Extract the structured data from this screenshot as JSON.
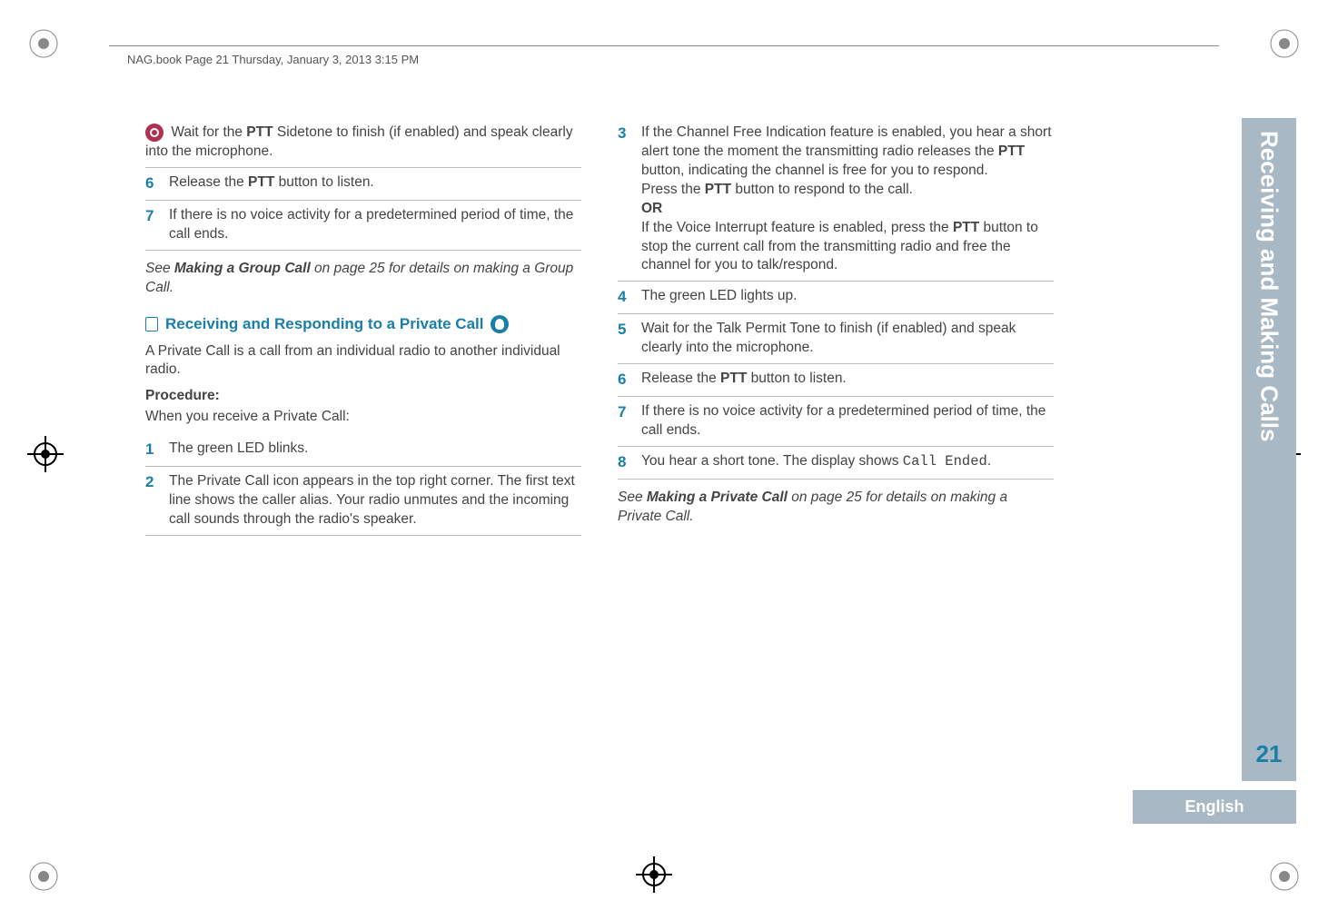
{
  "header": {
    "running_head": "NAG.book  Page 21  Thursday, January 3, 2013  3:15 PM"
  },
  "left_col": {
    "ptt_wait_text_prefix": " Wait for the ",
    "ptt_label": "PTT",
    "ptt_wait_text_suffix": " Sidetone to finish (if enabled) and speak clearly into the microphone.",
    "step6_num": "6",
    "step6_prefix": "Release the ",
    "step6_suffix": " button to listen.",
    "step7_num": "7",
    "step7_text": "If there is no voice activity for a predetermined period of time, the call ends.",
    "see_note_prefix": "See ",
    "see_note_bold": "Making a Group Call",
    "see_note_suffix": " on page 25 for details on making a Group Call.",
    "section_heading": "Receiving and Responding to a Private Call",
    "desc": "A Private Call is a call from an individual radio to another individual radio.",
    "procedure_label": "Procedure:",
    "procedure_sub": "When you receive a Private Call:",
    "pstep1_num": "1",
    "pstep1_text": "The green LED blinks.",
    "pstep2_num": "2",
    "pstep2_text": "The Private Call icon appears in the top right corner. The first text line shows the caller alias. Your radio unmutes and the incoming call sounds through the radio's speaker."
  },
  "right_col": {
    "step3_num": "3",
    "step3_l1_prefix": "If the Channel Free Indication feature is enabled, you hear a short alert tone the moment the transmitting radio releases the ",
    "step3_l1_mid": " button, indicating the channel is free for you to respond.",
    "step3_l2_prefix": "Press the ",
    "step3_l2_suffix": " button to respond to the call.",
    "or_label": "OR",
    "step3_l3_prefix": "If the Voice Interrupt feature is enabled, press the ",
    "step3_l3_suffix": " button to stop the current call from the transmitting radio and free the channel for you to talk/respond.",
    "step4_num": "4",
    "step4_text": "The green LED lights up.",
    "step5_num": "5",
    "step5_text": "Wait for the Talk Permit Tone to finish (if enabled) and speak clearly into the microphone.",
    "step6_num": "6",
    "step6_prefix": "Release the ",
    "step6_suffix": " button to listen.",
    "step7_num": "7",
    "step7_text": "If there is no voice activity for a predetermined period of time, the call ends.",
    "step8_num": "8",
    "step8_prefix": "You hear a short tone. The display shows ",
    "step8_mono": "Call Ended",
    "step8_suffix": ".",
    "see_note_prefix": "See ",
    "see_note_bold": "Making a Private Call",
    "see_note_suffix": " on page 25 for details on making a Private Call."
  },
  "side": {
    "tab_text": "Receiving and Making Calls",
    "page_number": "21",
    "language": "English"
  },
  "shared": {
    "ptt": "PTT"
  }
}
